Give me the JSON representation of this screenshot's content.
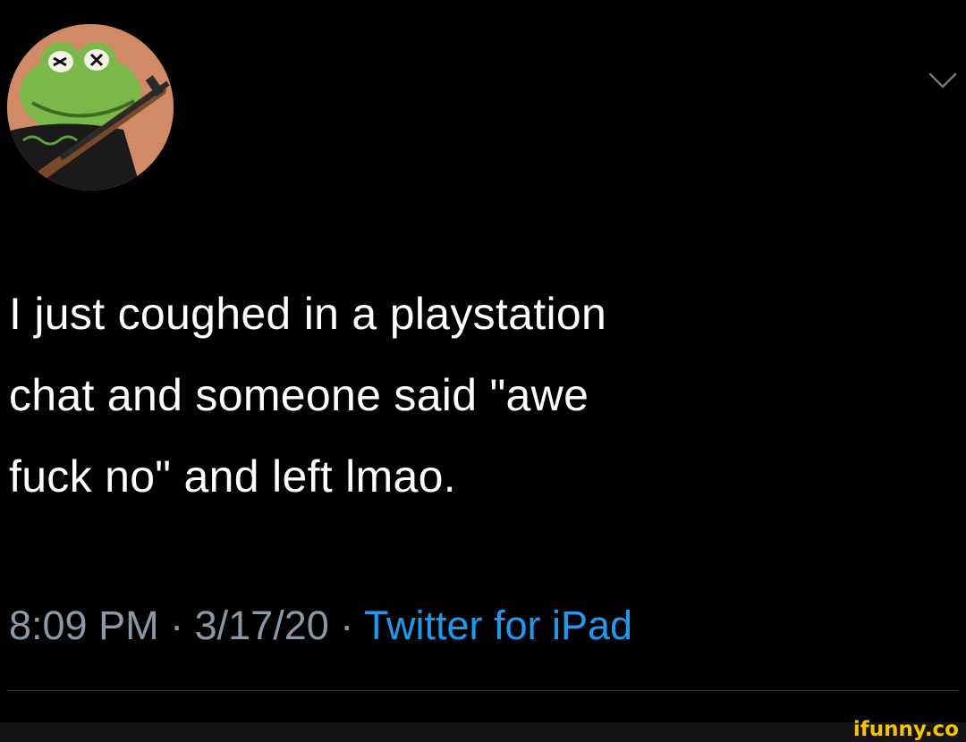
{
  "tweet": {
    "text": "I just coughed in a playstation\nchat and someone said \"awe\nfuck no\" and left lmao.",
    "time": "8:09 PM",
    "separator": "·",
    "date": "3/17/20",
    "source": "Twitter for iPad"
  },
  "icons": {
    "avatar": "frog-with-rifle-avatar",
    "more": "chevron-down-icon"
  },
  "colors": {
    "background": "#000000",
    "text": "#ffffff",
    "muted": "#8b98a5",
    "link": "#1d9bf0",
    "watermark": "#f5c400"
  },
  "watermark": "ifunny.co"
}
